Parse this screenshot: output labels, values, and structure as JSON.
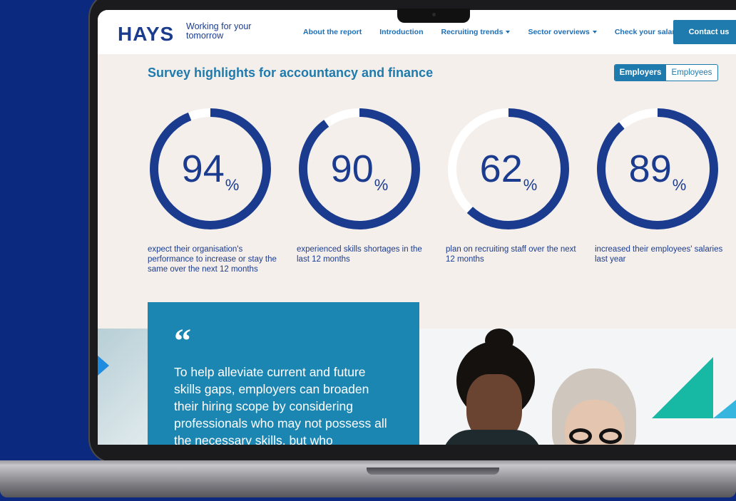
{
  "brand": {
    "logo": "HAYS",
    "tagline": "Working for your tomorrow"
  },
  "nav": {
    "links": [
      {
        "label": "About the report"
      },
      {
        "label": "Introduction"
      },
      {
        "label": "Recruiting trends"
      },
      {
        "label": "Sector overviews"
      },
      {
        "label": "Check your salary"
      }
    ],
    "contact": "Contact us"
  },
  "highlights": {
    "title": "Survey highlights for accountancy and finance",
    "toggle": {
      "options": [
        "Employers",
        "Employees"
      ],
      "selected": "Employers"
    },
    "stats": [
      {
        "value": "94",
        "unit": "%",
        "percent": 94,
        "description": "expect their organisation's performance to increase or stay the same over the next 12 months"
      },
      {
        "value": "90",
        "unit": "%",
        "percent": 90,
        "description": "experienced skills shortages in the last 12 months"
      },
      {
        "value": "62",
        "unit": "%",
        "percent": 62,
        "description": "plan on recruiting staff over the next 12 months"
      },
      {
        "value": "89",
        "unit": "%",
        "percent": 89,
        "description": "increased their employees' salaries last year"
      }
    ]
  },
  "quote": {
    "mark": "“",
    "text": "To help alleviate current and future skills gaps, employers can broaden their hiring scope by considering professionals who may not possess all the necessary skills, but who"
  },
  "colors": {
    "ring": "#1b3c8e",
    "ring_track": "#ffffff",
    "accent": "#1f7aad",
    "quote_bg": "#1c86b2",
    "page_bg": "#f4efeb"
  }
}
